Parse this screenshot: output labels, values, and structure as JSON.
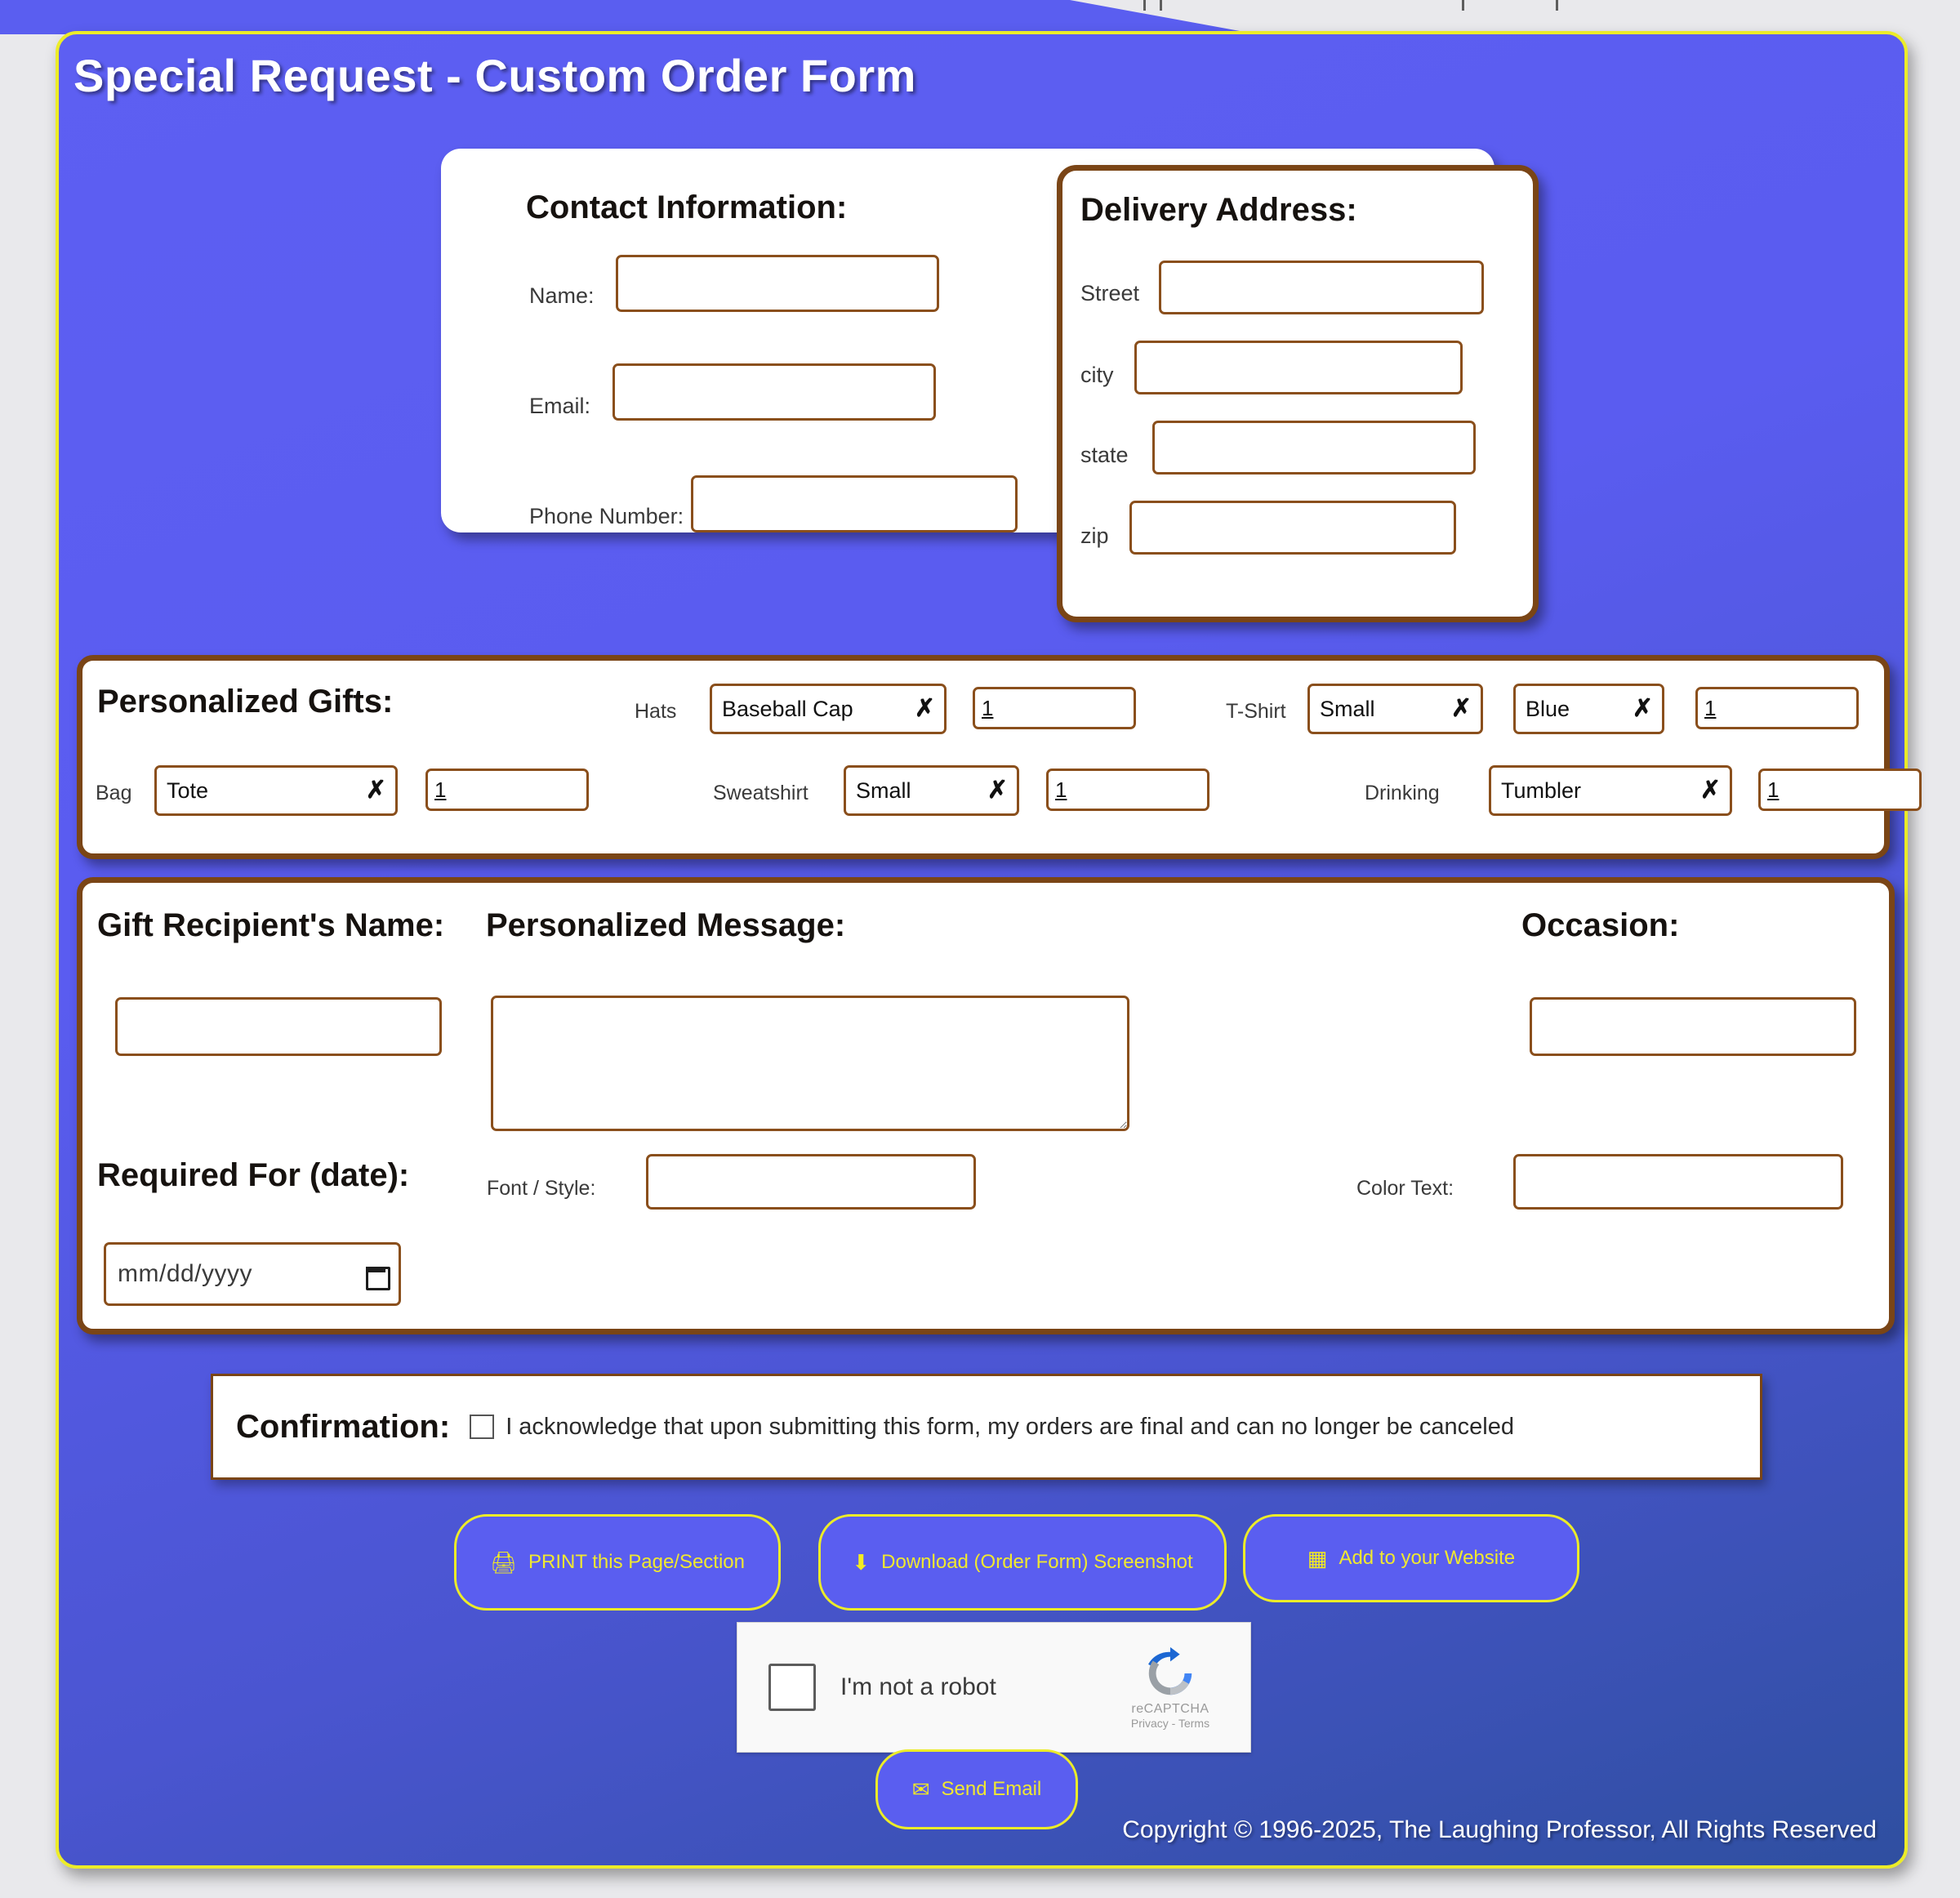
{
  "page": {
    "title": "Special Request - Custom Order Form",
    "copyright": "Copyright © 1996-2025, The Laughing Professor, All Rights Reserved",
    "accent_yellow": "#ecec28",
    "purple": "#5a5ef0",
    "brown": "#7a4516"
  },
  "contact": {
    "heading": "Contact Information:",
    "fields": [
      {
        "label": "Name:",
        "value": "",
        "placeholder": ""
      },
      {
        "label": "Email:",
        "value": "",
        "placeholder": ""
      },
      {
        "label": "Phone Number:",
        "value": "",
        "placeholder": ""
      }
    ]
  },
  "delivery": {
    "heading": "Delivery Address:",
    "fields": [
      {
        "label": "Street",
        "value": ""
      },
      {
        "label": "city",
        "value": ""
      },
      {
        "label": "state",
        "value": ""
      },
      {
        "label": "zip",
        "value": ""
      }
    ]
  },
  "gifts": {
    "heading": "Personalized Gifts:",
    "items": [
      {
        "label": "Hats",
        "option": "Baseball Cap",
        "qty": "1"
      },
      {
        "label": "T-Shirt",
        "option": "Small",
        "color": "Blue",
        "qty": "1"
      },
      {
        "label": "Bag",
        "option": "Tote",
        "qty": "1"
      },
      {
        "label": "Sweatshirt",
        "option": "Small",
        "qty": "1"
      },
      {
        "label": "Drinking",
        "option": "Tumbler",
        "qty": "1"
      }
    ]
  },
  "personalization": {
    "recipient_heading": "Gift Recipient's Name:",
    "recipient_value": "",
    "message_heading": "Personalized Message:",
    "message_value": "",
    "occasion_heading": "Occasion:",
    "occasion_value": "",
    "date_heading": "Required For (date):",
    "date_placeholder": "mm/dd/yyyy",
    "font_label": "Font / Style:",
    "font_value": "",
    "color_label": "Color Text:",
    "color_value": ""
  },
  "confirmation": {
    "heading": "Confirmation:",
    "checked": false,
    "acknowledgement": "I acknowledge that upon submitting this form, my orders are final and can no longer be canceled"
  },
  "actions": {
    "print": "PRINT this Page/Section",
    "download": "Download (Order Form) Screenshot",
    "add_site": "Add to your Website",
    "send": "Send Email"
  },
  "recaptcha": {
    "label": "I'm not a robot",
    "brand": "reCAPTCHA",
    "terms": "Privacy - Terms"
  }
}
